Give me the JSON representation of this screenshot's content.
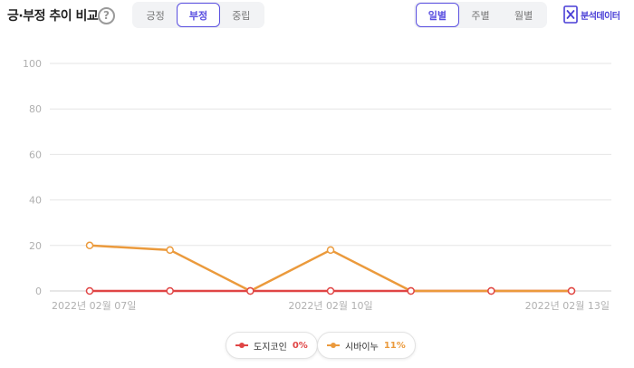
{
  "header": {
    "title": "긍·부정 추이 비교",
    "help": "?",
    "sentiment_tabs": [
      {
        "label": "긍정",
        "active": false
      },
      {
        "label": "부정",
        "active": true
      },
      {
        "label": "중립",
        "active": false
      }
    ],
    "period_tabs": [
      {
        "label": "일별",
        "active": true
      },
      {
        "label": "주별",
        "active": false
      },
      {
        "label": "월별",
        "active": false
      }
    ],
    "export_label": "분석데이터",
    "export_icon": "excel-icon"
  },
  "colors": {
    "accent": "#5a4fe0",
    "dogecoin": "#e04545",
    "shiba": "#eb9a3c",
    "grid": "#e6e6e6"
  },
  "legend": [
    {
      "name": "도지코인",
      "pct": "0%",
      "color": "#e04545"
    },
    {
      "name": "시바이누",
      "pct": "11%",
      "color": "#eb9a3c"
    }
  ],
  "chart_data": {
    "type": "line",
    "x": [
      "2022-02-07",
      "2022-02-08",
      "2022-02-09",
      "2022-02-10",
      "2022-02-11",
      "2022-02-12",
      "2022-02-13"
    ],
    "x_tick_labels": [
      {
        "index": 0,
        "label": "2022년 02월 07일"
      },
      {
        "index": 3,
        "label": "2022년 02월 10일"
      },
      {
        "index": 6,
        "label": "2022년 02월 13일"
      }
    ],
    "y_ticks": [
      0,
      20,
      40,
      60,
      80,
      100
    ],
    "ylim": [
      0,
      100
    ],
    "grid": true,
    "series": [
      {
        "name": "도지코인",
        "color": "#e04545",
        "values": [
          0,
          0,
          0,
          0,
          0,
          0,
          0
        ]
      },
      {
        "name": "시바이누",
        "color": "#eb9a3c",
        "values": [
          20,
          18,
          0,
          18,
          0,
          0,
          0
        ]
      }
    ],
    "legend_position": "bottom"
  }
}
